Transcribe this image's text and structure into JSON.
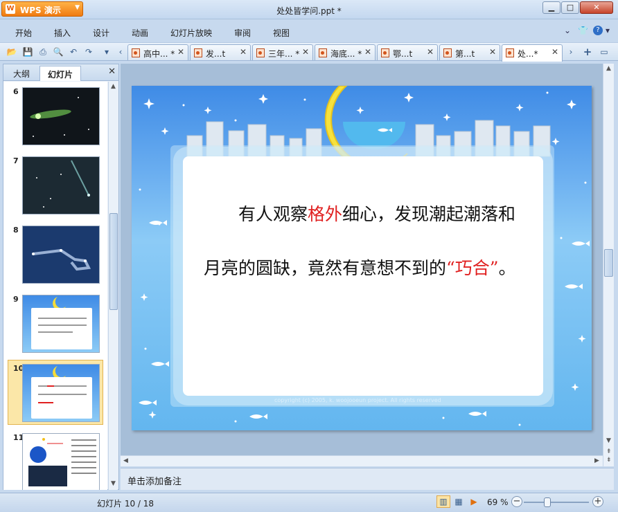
{
  "app": {
    "button_label": "WPS 演示",
    "window_title": "处处皆学问.ppt *"
  },
  "menu": [
    "开始",
    "插入",
    "设计",
    "动画",
    "幻灯片放映",
    "审阅",
    "视图"
  ],
  "doc_tabs": [
    {
      "label": "高中... *",
      "active": false
    },
    {
      "label": "发...t",
      "active": false
    },
    {
      "label": "三年... *",
      "active": false
    },
    {
      "label": "海底... *",
      "active": false
    },
    {
      "label": "鄂...t",
      "active": false
    },
    {
      "label": "第...t",
      "active": false
    },
    {
      "label": "处...*",
      "active": true
    }
  ],
  "left_panel": {
    "tab_outline": "大纲",
    "tab_slides": "幻灯片",
    "thumbnails": [
      {
        "num": "6"
      },
      {
        "num": "7"
      },
      {
        "num": "8"
      },
      {
        "num": "9"
      },
      {
        "num": "10",
        "selected": true
      },
      {
        "num": "11"
      }
    ]
  },
  "slide": {
    "text_before": "有人观察",
    "text_red1": "格外",
    "text_middle": "细心，发现潮起潮落和月亮的圆缺，竟然有意想不到的",
    "text_red2": "“巧合”",
    "text_after": "。",
    "copyright": "copyright (c) 2005, k. woojooeun project. All rights reserved"
  },
  "notes_placeholder": "单击添加备注",
  "status": {
    "slide_counter": "幻灯片 10 / 18",
    "zoom": "69 %"
  },
  "colors": {
    "accent_orange": "#f07b12",
    "highlight_red": "#e02020",
    "sky_blue": "#6fb2f1"
  }
}
